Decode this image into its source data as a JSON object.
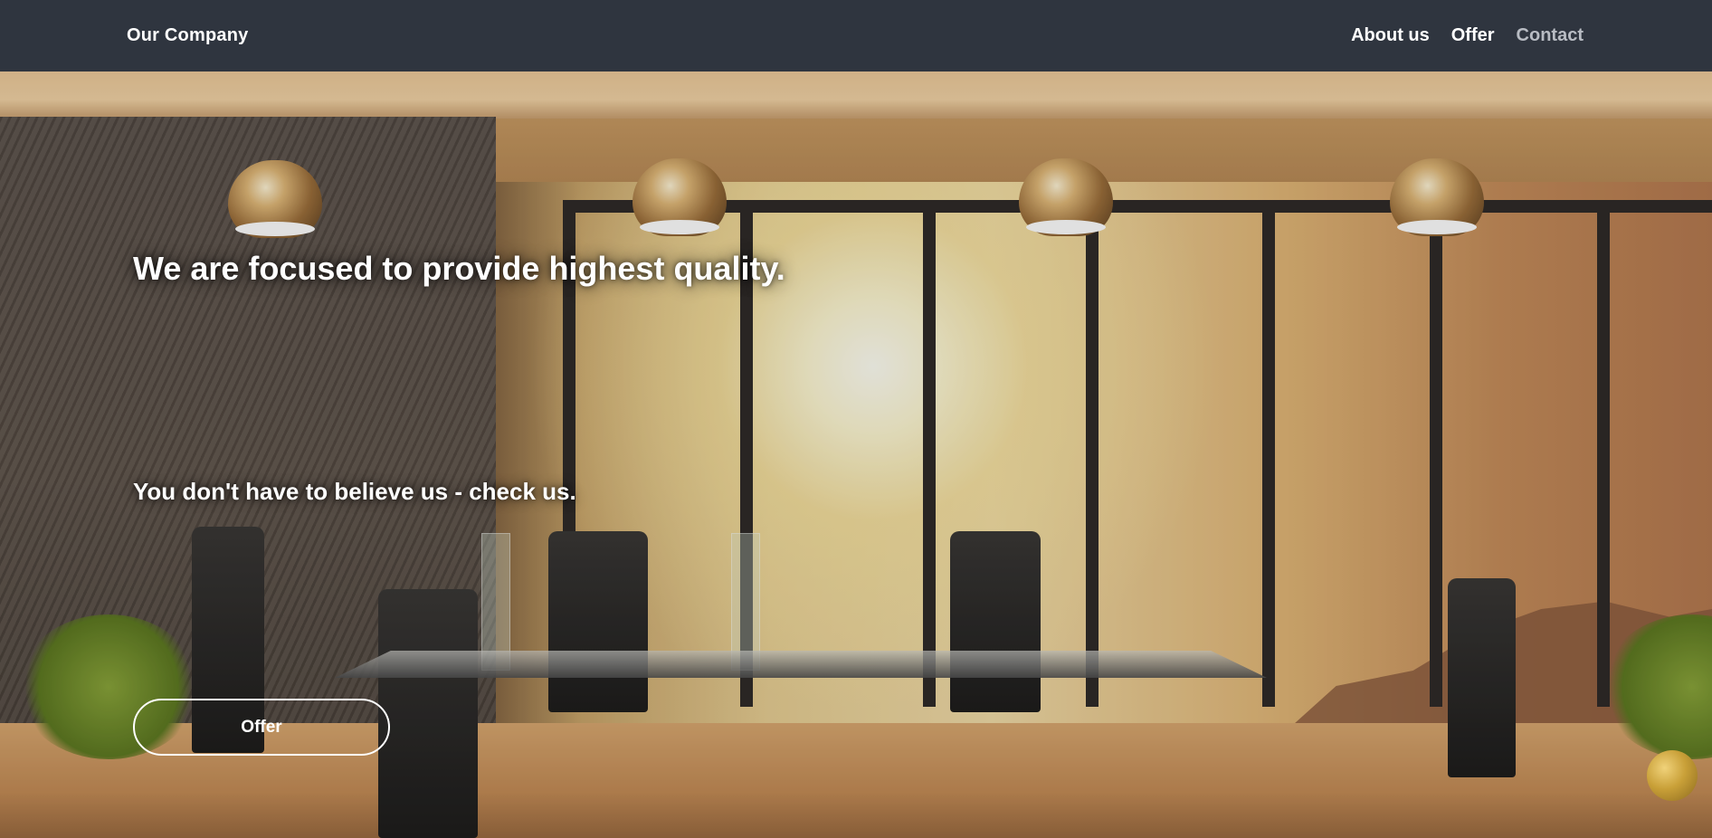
{
  "navbar": {
    "brand": "Our Company",
    "links": [
      {
        "label": "About us"
      },
      {
        "label": "Offer"
      },
      {
        "label": "Contact"
      }
    ]
  },
  "hero": {
    "headline": "We are focused to provide highest quality.",
    "subheadline": "You don't have to believe us - check us.",
    "cta_label": "Offer"
  },
  "colors": {
    "navbar_bg": "#2f353f",
    "nav_text": "#ffffff",
    "nav_text_muted": "#b8bcc3"
  }
}
